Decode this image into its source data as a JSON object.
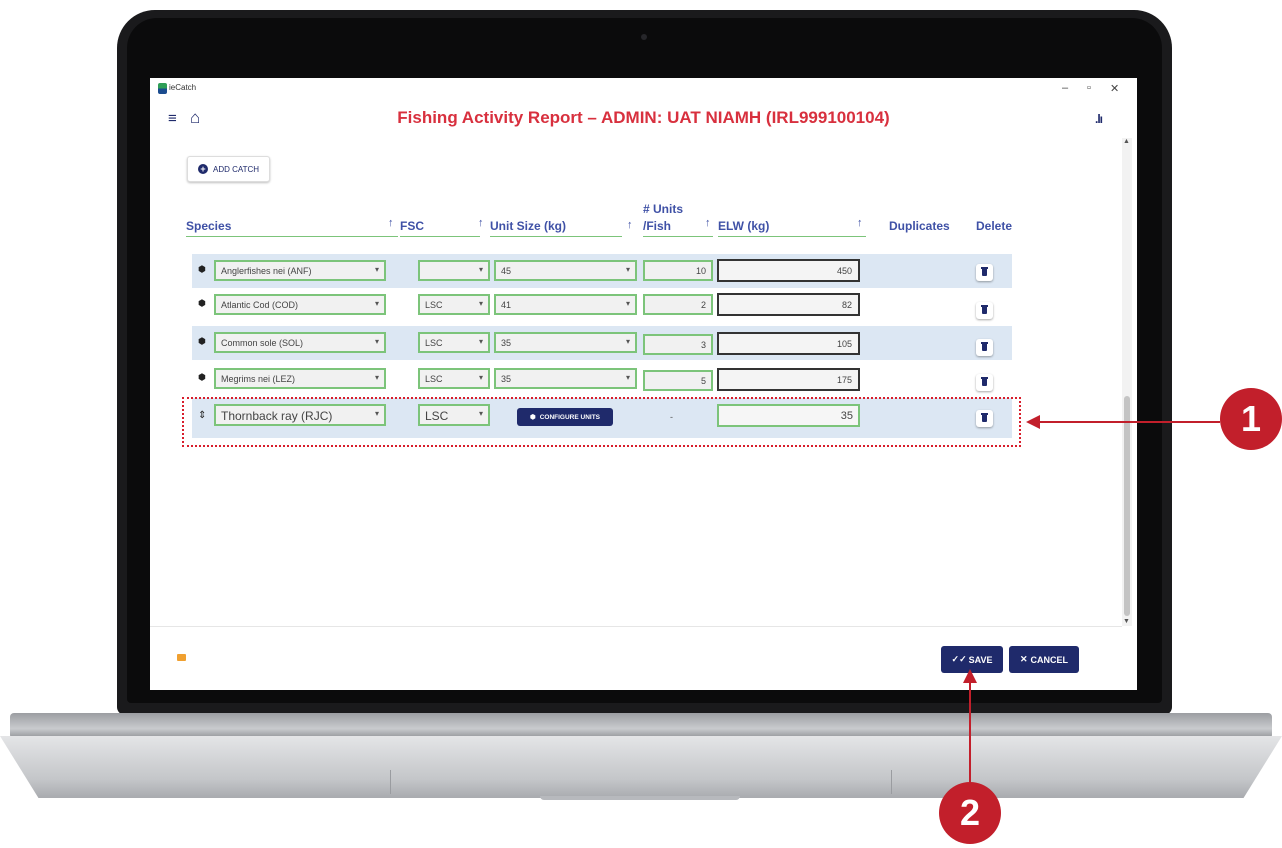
{
  "app": {
    "name": "ieCatch"
  },
  "window": {
    "minimize": "–",
    "restore": "▫",
    "close": "✕"
  },
  "header": {
    "menu_icon": "≡",
    "home_icon": "⌂",
    "title": "Fishing Activity Report – ADMIN: UAT NIAMH (IRL999100104)",
    "stats_icon": ".lı"
  },
  "toolbar": {
    "add_catch_label": "ADD CATCH"
  },
  "table": {
    "columns": {
      "species": "Species",
      "fsc": "FSC",
      "unit_size": "Unit Size (kg)",
      "units_per_fish_line1": "# Units",
      "units_per_fish_line2": "/Fish",
      "elw": "ELW (kg)",
      "duplicates": "Duplicates",
      "delete": "Delete"
    },
    "sort_glyph": "↑",
    "rows": [
      {
        "species": "Anglerfishes nei (ANF)",
        "fsc": "",
        "unit_size": "45",
        "units": "10",
        "elw": "450"
      },
      {
        "species": "Atlantic Cod (COD)",
        "fsc": "LSC",
        "unit_size": "41",
        "units": "2",
        "elw": "82"
      },
      {
        "species": "Common sole (SOL)",
        "fsc": "LSC",
        "unit_size": "35",
        "units": "3",
        "elw": "105"
      },
      {
        "species": "Megrims nei (LEZ)",
        "fsc": "LSC",
        "unit_size": "35",
        "units": "5",
        "elw": "175"
      }
    ],
    "new_row": {
      "species": "Thornback ray (RJC)",
      "fsc": "LSC",
      "configure_label": "CONFIGURE UNITS",
      "units": "-",
      "elw": "35"
    }
  },
  "footer": {
    "save_label": "SAVE",
    "cancel_label": "CANCEL"
  },
  "annotations": {
    "callout_1": "1",
    "callout_2": "2"
  },
  "colors": {
    "title_red": "#d8303e",
    "navy": "#1f2a6b",
    "header_blue": "#3f51a6",
    "field_green": "#7cc47a",
    "row_shade": "#dce7f3",
    "callout_red": "#c21f2b"
  }
}
